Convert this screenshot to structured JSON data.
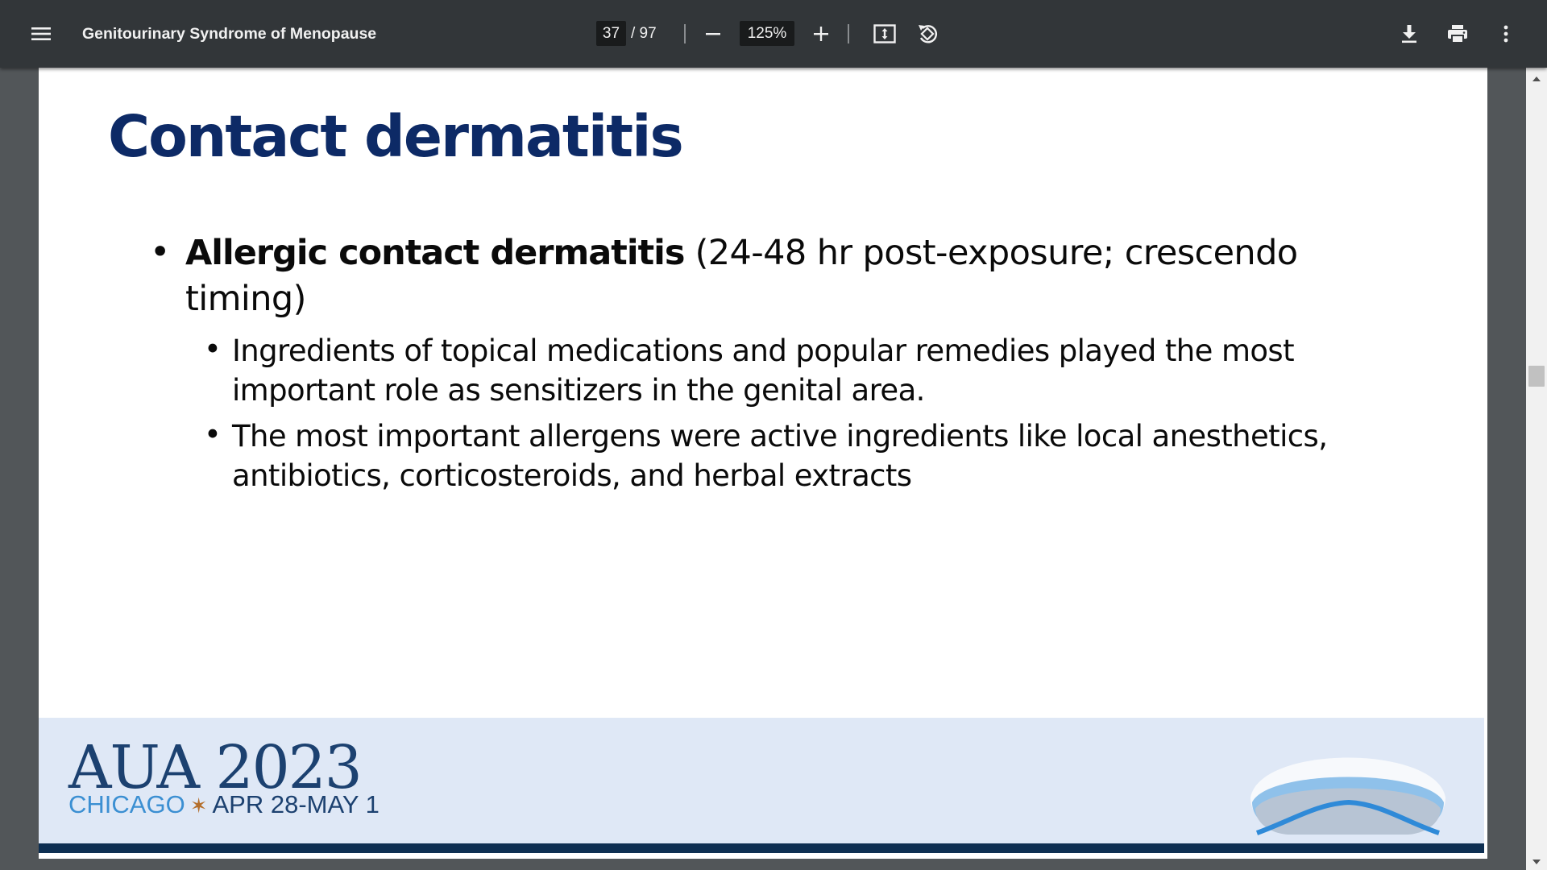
{
  "toolbar": {
    "title": "Genitourinary Syndrome of Menopause",
    "current_page": "37",
    "page_separator": "/ 97",
    "zoom": "125%",
    "icons": [
      "menu-icon",
      "zoom-out-icon",
      "zoom-in-icon",
      "fit-page-icon",
      "rotate-icon",
      "download-icon",
      "print-icon",
      "more-options-icon"
    ]
  },
  "slide": {
    "title": "Contact dermatitis",
    "bullet1": {
      "bold": "Allergic contact  dermatitis",
      "rest": " (24-48 hr post-exposure; crescendo timing)"
    },
    "sub_bullets": [
      "Ingredients of topical medications and popular remedies played the most important role as sensitizers in the genital area.",
      "The most important allergens were active ingredients like local anesthetics, antibiotics, corticosteroids, and herbal extracts"
    ],
    "footer": {
      "logo_main": "AUA 2023",
      "city": "CHICAGO",
      "star": "✶",
      "dates": "APR 28-MAY 1"
    }
  },
  "colors": {
    "toolbar_bg": "#323639",
    "viewer_bg": "#525659",
    "title_color": "#0d2a66",
    "banner_bg": "#dfe8f6",
    "banner_bar": "#0e2f52"
  }
}
